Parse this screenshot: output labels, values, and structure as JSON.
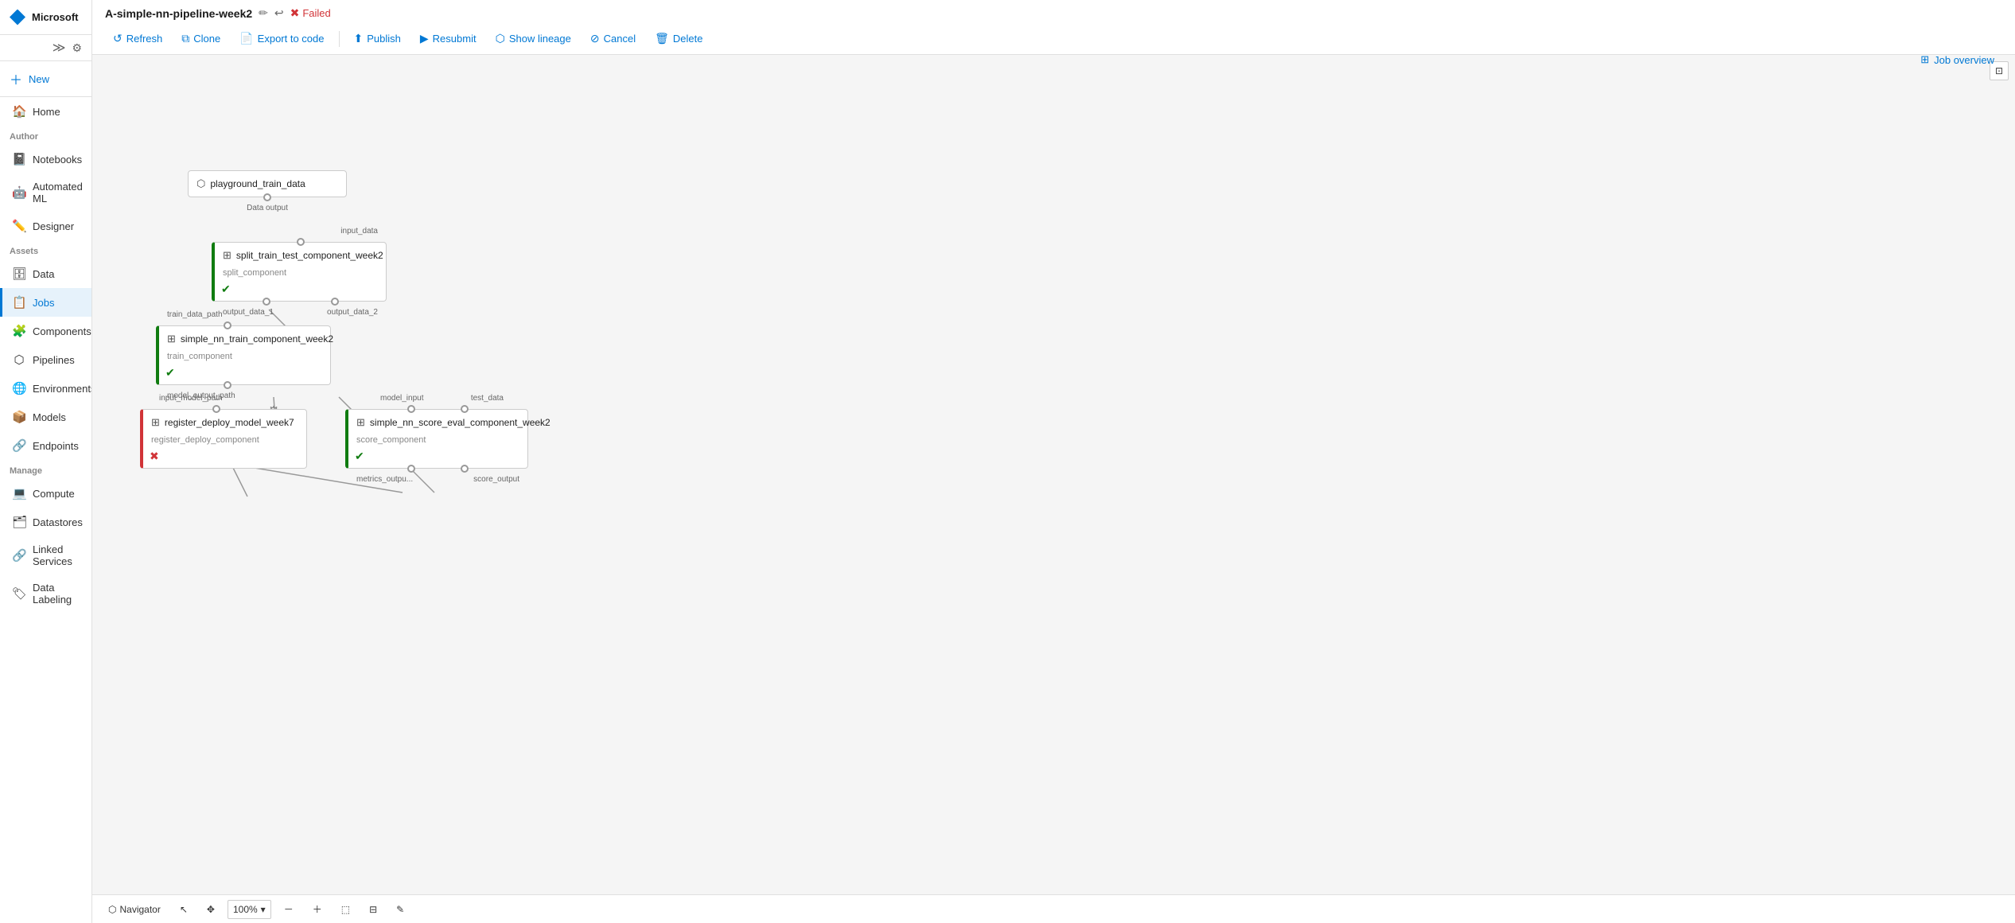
{
  "app": {
    "name": "Microsoft"
  },
  "sidebar": {
    "logo": "Microsoft",
    "new_label": "New",
    "home_label": "Home",
    "author_section": "Author",
    "notebooks_label": "Notebooks",
    "automated_ml_label": "Automated ML",
    "designer_label": "Designer",
    "assets_section": "Assets",
    "data_label": "Data",
    "jobs_label": "Jobs",
    "components_label": "Components",
    "pipelines_label": "Pipelines",
    "environments_label": "Environments",
    "models_label": "Models",
    "endpoints_label": "Endpoints",
    "manage_section": "Manage",
    "compute_label": "Compute",
    "datastores_label": "Datastores",
    "linked_services_label": "Linked Services",
    "data_labeling_label": "Data Labeling"
  },
  "pipeline": {
    "title": "A-simple-nn-pipeline-week2",
    "status": "Failed"
  },
  "toolbar": {
    "refresh_label": "Refresh",
    "clone_label": "Clone",
    "export_to_code_label": "Export to code",
    "publish_label": "Publish",
    "resubmit_label": "Resubmit",
    "show_lineage_label": "Show lineage",
    "cancel_label": "Cancel",
    "delete_label": "Delete",
    "job_overview_label": "Job overview"
  },
  "nodes": {
    "playground": {
      "title": "playground_train_data",
      "port_label": "Data output"
    },
    "split": {
      "title": "split_train_test_component_week2",
      "subtitle": "split_component",
      "status": "success",
      "port_left": "output_data_1",
      "port_right": "output_data_2",
      "input_label": "input_data"
    },
    "train": {
      "title": "simple_nn_train_component_week2",
      "subtitle": "train_component",
      "status": "success",
      "port_label": "model_output_path",
      "input_label": "train_data_path"
    },
    "register": {
      "title": "register_deploy_model_week7",
      "subtitle": "register_deploy_component",
      "status": "error",
      "input_label1": "input_model_path"
    },
    "score": {
      "title": "simple_nn_score_eval_component_week2",
      "subtitle": "score_component",
      "status": "success",
      "input_label1": "model_input",
      "input_label2": "test_data",
      "port_label1": "metrics_outpu...",
      "port_label2": "score_output"
    }
  },
  "bottom_toolbar": {
    "navigator_label": "Navigator",
    "zoom_level": "100%"
  }
}
